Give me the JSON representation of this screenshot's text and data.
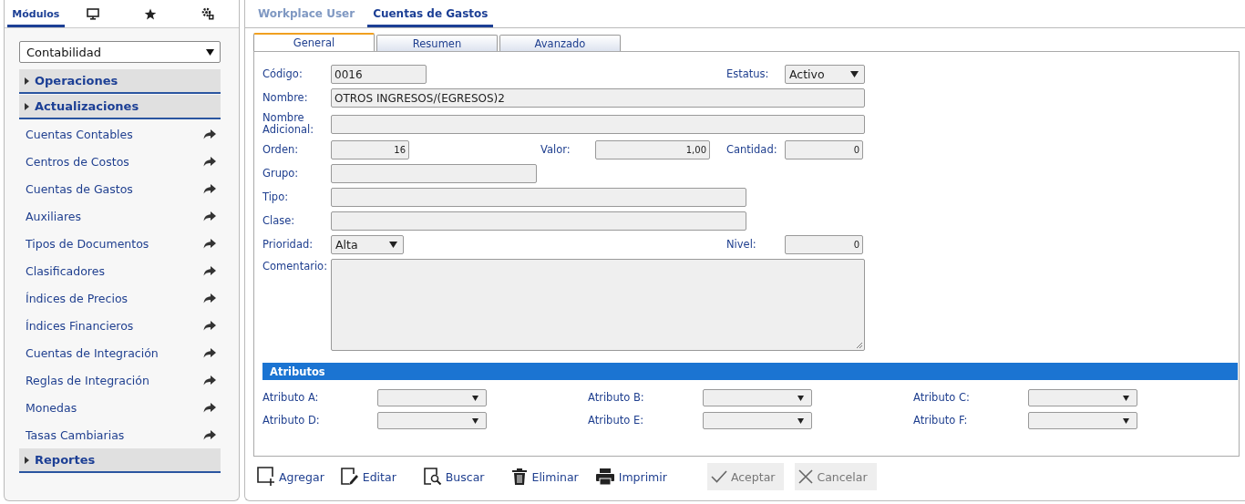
{
  "sidebar": {
    "tabs": [
      {
        "kind": "text",
        "label": "Módulos",
        "selected": true
      },
      {
        "kind": "monitor",
        "selected": false
      },
      {
        "kind": "star",
        "selected": false
      },
      {
        "kind": "gears",
        "selected": false
      }
    ],
    "module_select": {
      "value": "Contabilidad"
    },
    "sections": [
      {
        "label": "Operaciones"
      },
      {
        "label": "Actualizaciones",
        "items": [
          "Cuentas Contables",
          "Centros de Costos",
          "Cuentas de Gastos",
          "Auxiliares",
          "Tipos de Documentos",
          "Clasificadores",
          "Índices de Precios",
          "Índices Financieros",
          "Cuentas de Integración",
          "Reglas de Integración",
          "Monedas",
          "Tasas Cambiarias"
        ]
      },
      {
        "label": "Reportes"
      }
    ]
  },
  "main_tabs": [
    {
      "label": "Workplace User",
      "selected": false
    },
    {
      "label": "Cuentas de Gastos",
      "selected": true
    }
  ],
  "form_tabs": [
    {
      "label": "General",
      "selected": true
    },
    {
      "label": "Resumen",
      "selected": false
    },
    {
      "label": "Avanzado",
      "selected": false
    }
  ],
  "fields": [
    {
      "label": "Código:",
      "kind": "input",
      "value": "0016"
    },
    {
      "label": "Estatus:",
      "kind": "select",
      "value": "Activo"
    },
    {
      "label": "Nombre:",
      "kind": "input",
      "value": "OTROS INGRESOS/(EGRESOS)2"
    },
    {
      "label": "Nombre Adicional:",
      "kind": "input"
    },
    {
      "label": "Orden:",
      "kind": "number",
      "value": "16"
    },
    {
      "label": "Valor:",
      "kind": "number",
      "value": "1,00"
    },
    {
      "label": "Cantidad:",
      "kind": "number",
      "value": "0"
    },
    {
      "label": "Grupo:",
      "kind": "input"
    },
    {
      "label": "Tipo:",
      "kind": "input"
    },
    {
      "label": "Clase:",
      "kind": "input"
    },
    {
      "label": "Prioridad:",
      "kind": "select",
      "value": "Alta"
    },
    {
      "label": "Nivel:",
      "kind": "number",
      "value": "0"
    },
    {
      "label": "Comentario:",
      "kind": "textarea"
    }
  ],
  "attributes": {
    "title": "Atributos",
    "items": [
      "Atributo A:",
      "Atributo B:",
      "Atributo C:",
      "Atributo D:",
      "Atributo E:",
      "Atributo F:"
    ]
  },
  "toolbar": [
    {
      "kind": "add",
      "label": "Agregar",
      "disabled": false
    },
    {
      "kind": "edit",
      "label": "Editar",
      "disabled": false
    },
    {
      "kind": "search",
      "label": "Buscar",
      "disabled": false
    },
    {
      "kind": "delete",
      "label": "Eliminar",
      "disabled": false
    },
    {
      "kind": "print",
      "label": "Imprimir",
      "disabled": false
    },
    {
      "kind": "accept",
      "label": "Aceptar",
      "disabled": true
    },
    {
      "kind": "cancel",
      "label": "Cancelar",
      "disabled": true
    }
  ]
}
